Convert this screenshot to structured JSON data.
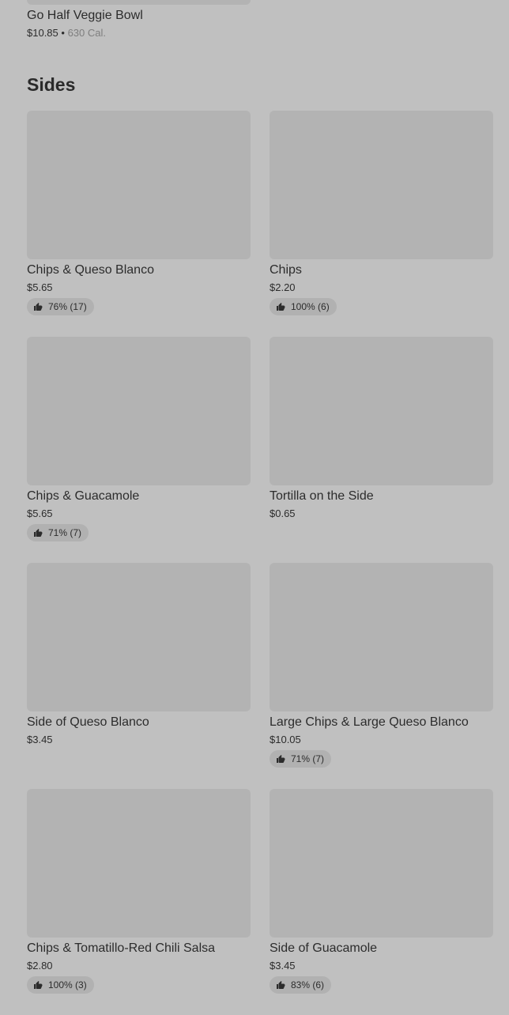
{
  "previous_item": {
    "name": "Go Half Veggie Bowl",
    "price": "$10.85",
    "separator": "•",
    "calories": "630 Cal."
  },
  "section": {
    "title": "Sides"
  },
  "items": [
    {
      "name": "Chips & Queso Blanco",
      "price": "$5.65",
      "rating": "76% (17)"
    },
    {
      "name": "Chips",
      "price": "$2.20",
      "rating": "100% (6)"
    },
    {
      "name": "Chips & Guacamole",
      "price": "$5.65",
      "rating": "71% (7)"
    },
    {
      "name": "Tortilla on the Side",
      "price": "$0.65",
      "rating": ""
    },
    {
      "name": "Side of Queso Blanco",
      "price": "$3.45",
      "rating": ""
    },
    {
      "name": "Large Chips & Large Queso Blanco",
      "price": "$10.05",
      "rating": "71% (7)"
    },
    {
      "name": "Chips & Tomatillo-Red Chili Salsa",
      "price": "$2.80",
      "rating": "100% (3)"
    },
    {
      "name": "Side of Guacamole",
      "price": "$3.45",
      "rating": "83% (6)"
    }
  ],
  "icons": {
    "rating": "thumbs-up-icon"
  }
}
